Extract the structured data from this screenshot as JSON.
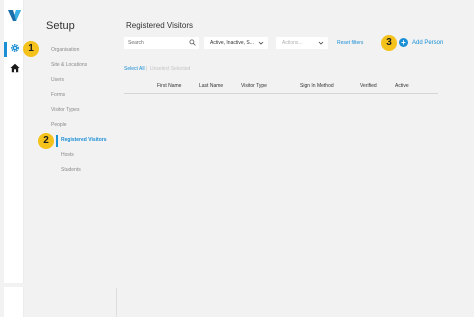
{
  "rail": {
    "logo_icon": "brand-v-logo-icon",
    "items": [
      {
        "icon": "gear-icon",
        "active": true
      },
      {
        "icon": "home-icon",
        "active": false
      }
    ]
  },
  "badges": [
    "1",
    "2",
    "3"
  ],
  "sidebar": {
    "title": "Setup",
    "items": [
      {
        "label": "Organisation"
      },
      {
        "label": "Site & Locations"
      },
      {
        "label": "Users"
      },
      {
        "label": "Forms"
      },
      {
        "label": "Visitor Types"
      },
      {
        "label": "People"
      },
      {
        "label": "Registered Visitors"
      },
      {
        "label": "Hosts"
      },
      {
        "label": "Students"
      }
    ]
  },
  "main": {
    "title": "Registered Visitors",
    "search_placeholder": "Search",
    "status_filter": "Active, Inactive, S...",
    "actions_placeholder": "Actions...",
    "reset_label": "Reset filters",
    "add_person_label": "Add Person",
    "select_all_label": "Select All",
    "separator": "|",
    "unselect_label": "Unselect Selected",
    "columns": [
      "First Name",
      "Last Name",
      "Visitor Type",
      "Sign In Method",
      "Verified",
      "Active"
    ]
  },
  "colors": {
    "accent": "#1a8fd6",
    "badge": "#f5c21b",
    "background": "#f2f2f2"
  }
}
